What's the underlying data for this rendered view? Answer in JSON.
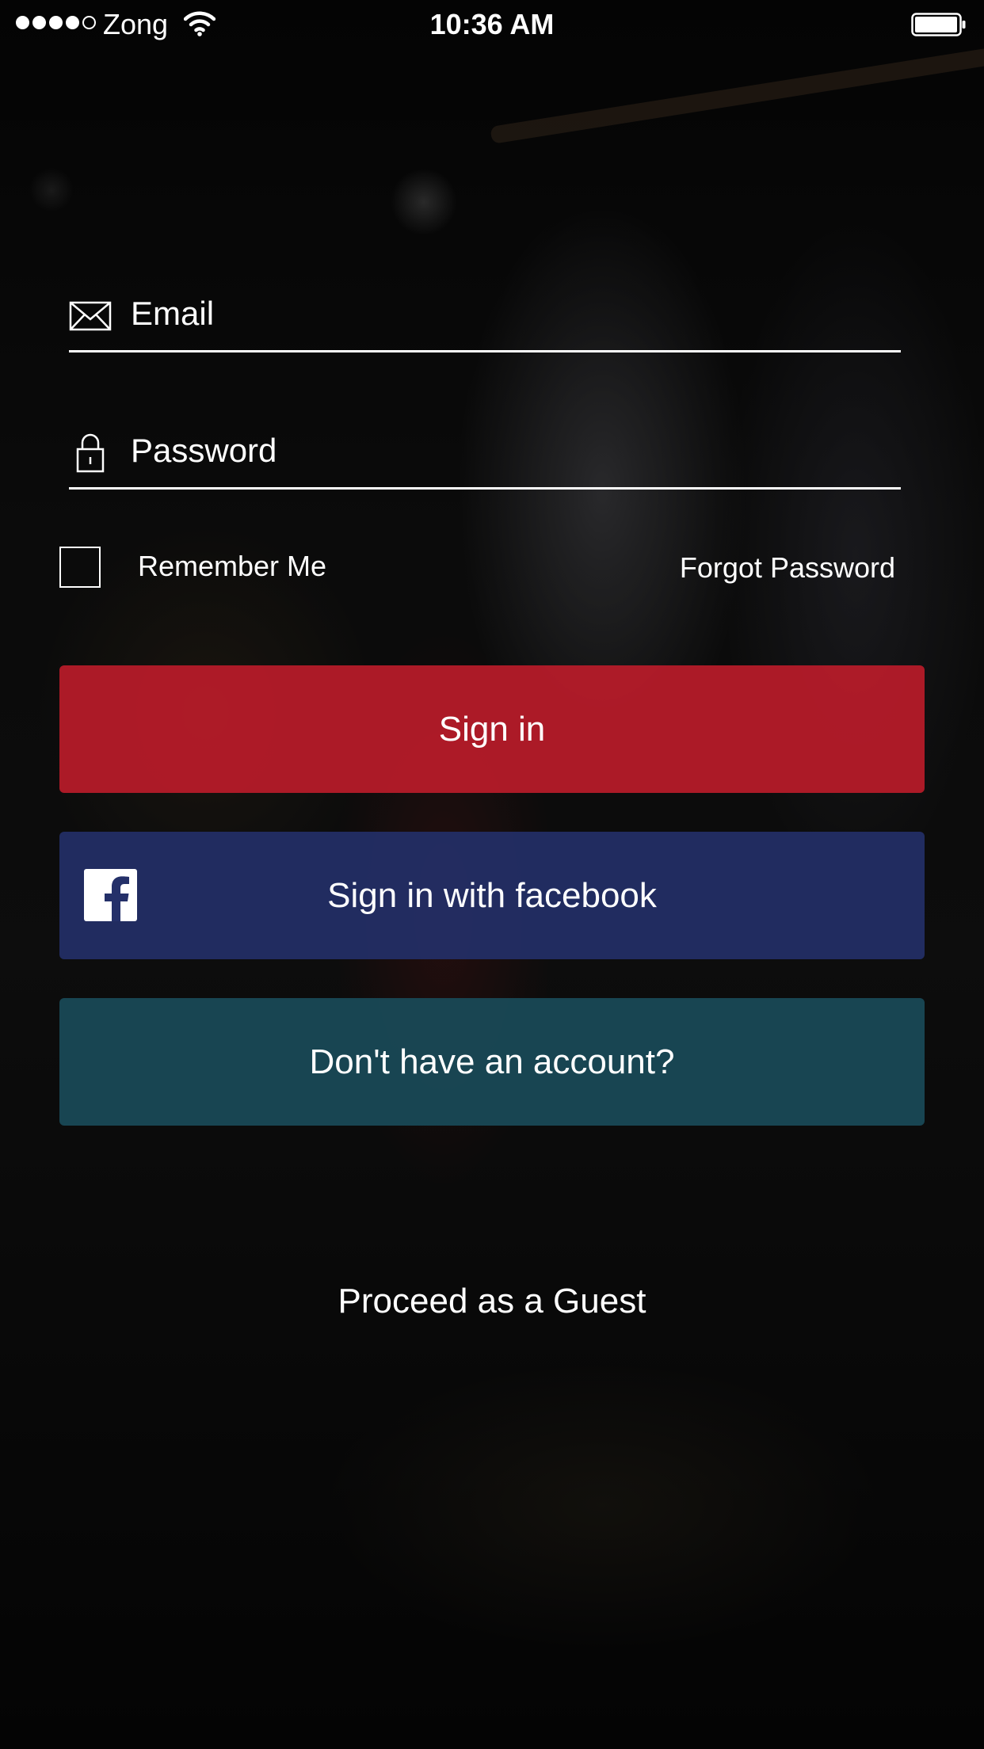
{
  "status_bar": {
    "carrier": "Zong",
    "time": "10:36 AM",
    "signal_bars_filled": 4,
    "signal_bars_total": 5
  },
  "login_form": {
    "email_placeholder": "Email",
    "password_placeholder": "Password",
    "remember_me_label": "Remember Me",
    "remember_me_checked": false,
    "forgot_password_label": "Forgot Password"
  },
  "buttons": {
    "sign_in": "Sign in",
    "facebook": "Sign in with facebook",
    "register": "Don't have an account?"
  },
  "guest_link": "Proceed as a Guest",
  "icons": {
    "email": "envelope-icon",
    "password": "lock-icon",
    "facebook": "facebook-logo-icon",
    "wifi": "wifi-icon",
    "battery": "battery-icon"
  },
  "colors": {
    "sign_in": "#be1c2a",
    "facebook": "#243069",
    "register": "#1a4b5a"
  }
}
